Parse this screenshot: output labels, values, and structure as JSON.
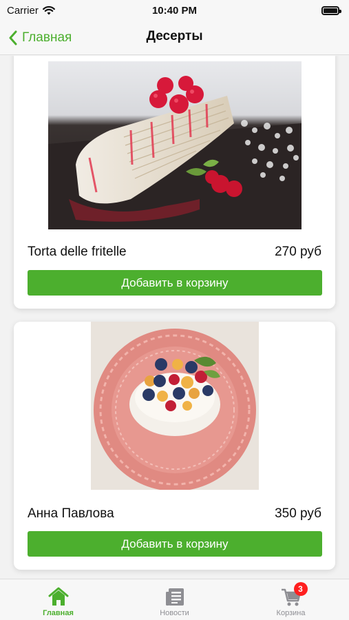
{
  "status_bar": {
    "carrier": "Carrier",
    "time": "10:40 PM"
  },
  "nav": {
    "back_label": "Главная",
    "title": "Десерты"
  },
  "products": [
    {
      "name": "Torta delle fritelle",
      "price": "270 руб",
      "button_label": "Добавить в корзину"
    },
    {
      "name": "Анна Павлова",
      "price": "350 руб",
      "button_label": "Добавить в корзину"
    }
  ],
  "tab_bar": {
    "tabs": [
      {
        "label": "Главная",
        "icon": "home-icon",
        "active": true
      },
      {
        "label": "Новости",
        "icon": "news-icon",
        "active": false
      },
      {
        "label": "Корзина",
        "icon": "cart-icon",
        "active": false,
        "badge": "3"
      }
    ]
  },
  "colors": {
    "accent": "#4caf2e",
    "badge": "#ff1f1f",
    "inactive_tab": "#8e8e93"
  }
}
